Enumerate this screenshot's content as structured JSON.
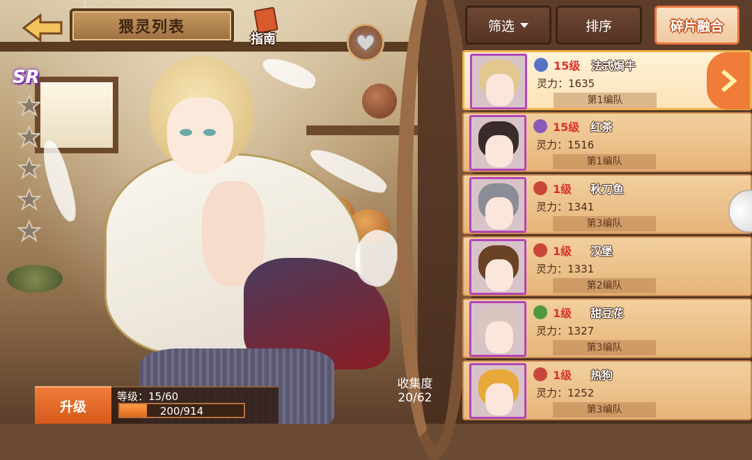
{
  "header": {
    "title": "猥灵列表",
    "guide_label": "指南"
  },
  "rarity": "SR",
  "stars": 5,
  "level": {
    "button_label": "升级",
    "level_text": "等级：15/60",
    "exp_text": "200/914",
    "exp_fraction": 0.219
  },
  "collection": {
    "label": "收集度",
    "value": "20/62"
  },
  "toolbar": {
    "filter_label": "筛选",
    "sort_label": "排序",
    "fusion_label": "碎片融合"
  },
  "cards": [
    {
      "level": "15级",
      "name": "法式焗牛",
      "power": "灵力：1635",
      "team": "第1编队",
      "type": "shield-icon",
      "type_color": "#5574c8",
      "hair": "#e2c88f",
      "selected": true
    },
    {
      "level": "15级",
      "name": "红茶",
      "power": "灵力：1516",
      "team": "第1编队",
      "type": "star-icon",
      "type_color": "#8a5ab8",
      "hair": "#3a2b2b",
      "selected": false
    },
    {
      "level": "1级",
      "name": "秋刀鱼",
      "power": "灵力：1341",
      "team": "第3编队",
      "type": "swords-icon",
      "type_color": "#c9473a",
      "hair": "#8a8c96",
      "selected": false
    },
    {
      "level": "1级",
      "name": "汉堡",
      "power": "灵力：1331",
      "team": "第2编队",
      "type": "swords-icon",
      "type_color": "#c9473a",
      "hair": "#6a4326",
      "selected": false
    },
    {
      "level": "1级",
      "name": "甜豆花",
      "power": "灵力：1327",
      "team": "第3编队",
      "type": "plus-icon",
      "type_color": "#4e9a3c",
      "hair": "#d9c6bf",
      "selected": false
    },
    {
      "level": "1级",
      "name": "热狗",
      "power": "灵力：1252",
      "team": "第3编队",
      "type": "swords-icon",
      "type_color": "#c9473a",
      "hair": "#e8a93a",
      "selected": false
    }
  ]
}
